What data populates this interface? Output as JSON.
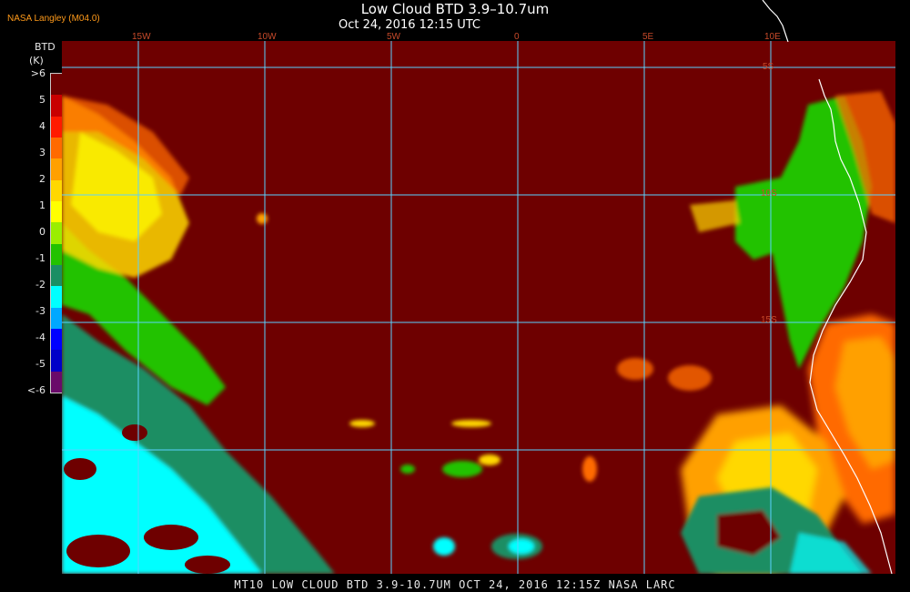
{
  "header": {
    "title": "Low Cloud BTD 3.9–10.7um",
    "subtitle": "Oct 24, 2016 12:15 UTC",
    "producer": "NASA Langley (M04.0)"
  },
  "colorbar": {
    "title": "BTD",
    "units": "(K)",
    "ticks": [
      ">6",
      "5",
      "4",
      "3",
      "2",
      "1",
      "0",
      "-1",
      "-2",
      "-3",
      "-4",
      "-5",
      "<-6"
    ],
    "colors": [
      "#6e0000",
      "#c80000",
      "#ff1a00",
      "#ff6a00",
      "#ffa000",
      "#ffd800",
      "#ffff00",
      "#9aee00",
      "#22c200",
      "#1a8e64",
      "#00ffff",
      "#00a8ff",
      "#0000ff",
      "#0000c8",
      "#6a0a6a"
    ]
  },
  "map": {
    "lon_labels": [
      "15W",
      "10W",
      "5W",
      "0",
      "5E",
      "10E"
    ],
    "lat_labels": [
      "5S",
      "10S",
      "15S"
    ],
    "background_color": "#6e0000",
    "grid_color": "#5ad2ff",
    "coast_color": "#ffffff"
  },
  "footer": {
    "text": "MT10  LOW CLOUD BTD 3.9-10.7UM   OCT 24, 2016 12:15Z   NASA LARC"
  }
}
